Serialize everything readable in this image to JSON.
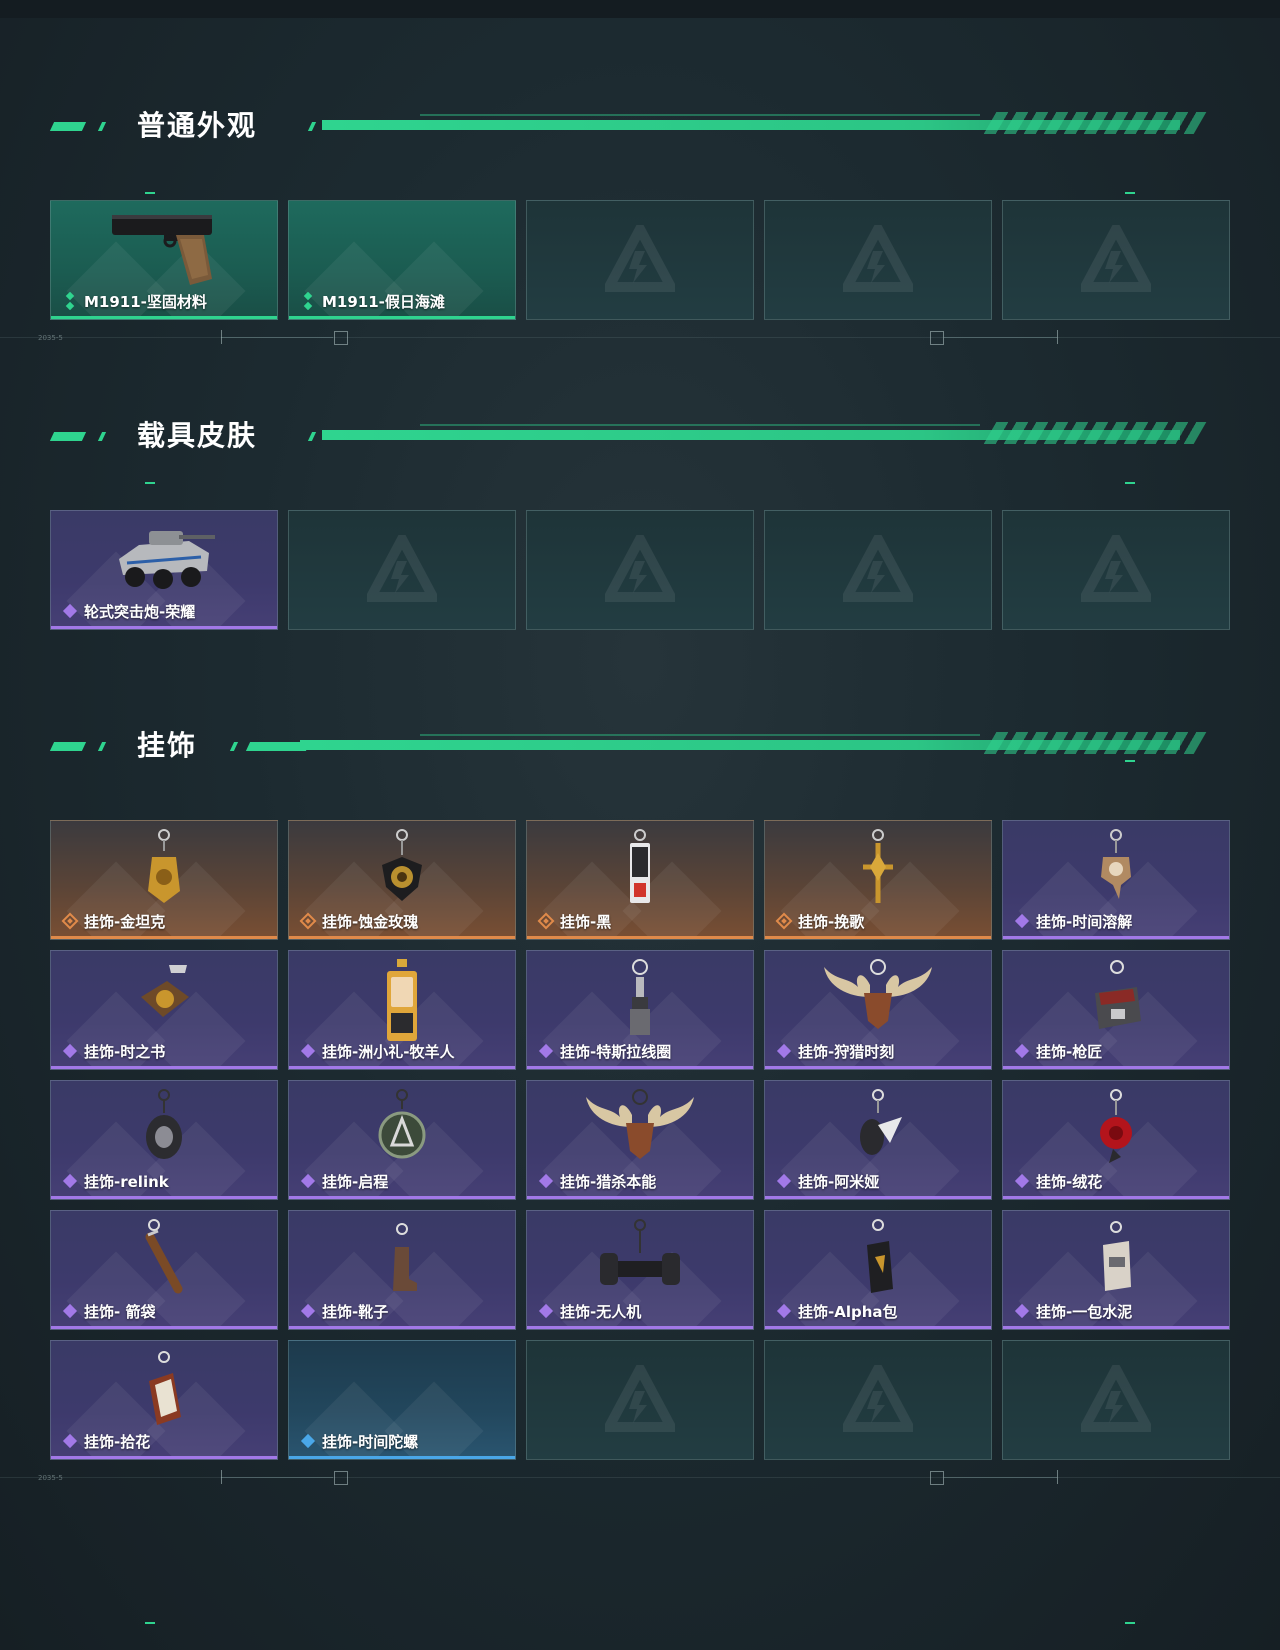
{
  "sections": {
    "normal": {
      "title": "普通外观",
      "items": [
        {
          "label": "M1911-坚固材料",
          "rarity": "green",
          "icon": "pistol-icon"
        },
        {
          "label": "M1911-假日海滩",
          "rarity": "green",
          "icon": ""
        }
      ]
    },
    "vehicle": {
      "title": "载具皮肤",
      "items": [
        {
          "label": "轮式突击炮-荣耀",
          "rarity": "purple",
          "icon": "armored-vehicle-icon"
        }
      ]
    },
    "charms": {
      "title": "挂饰",
      "items": [
        {
          "label": "挂饰-金坦克",
          "rarity": "orange",
          "icon": "gold-tank-charm-icon"
        },
        {
          "label": "挂饰-蚀金玫瑰",
          "rarity": "orange",
          "icon": "black-rose-charm-icon"
        },
        {
          "label": "挂饰-黑",
          "rarity": "orange",
          "icon": "card-charm-icon"
        },
        {
          "label": "挂饰-挽歌",
          "rarity": "orange",
          "icon": "golden-cross-charm-icon"
        },
        {
          "label": "挂饰-时间溶解",
          "rarity": "purple",
          "icon": "melting-clock-charm-icon"
        },
        {
          "label": "挂饰-时之书",
          "rarity": "purple",
          "icon": "book-charm-icon"
        },
        {
          "label": "挂饰-洲小礼-牧羊人",
          "rarity": "purple",
          "icon": "gift-box-charm-icon"
        },
        {
          "label": "挂饰-特斯拉线圈",
          "rarity": "purple",
          "icon": "tesla-coil-charm-icon"
        },
        {
          "label": "挂饰-狩猎时刻",
          "rarity": "purple",
          "icon": "antler-charm-icon"
        },
        {
          "label": "挂饰-枪匠",
          "rarity": "purple",
          "icon": "toolbox-charm-icon"
        },
        {
          "label": "挂饰-relink",
          "rarity": "purple",
          "icon": "turtle-charm-icon"
        },
        {
          "label": "挂饰-启程",
          "rarity": "purple",
          "icon": "compass-charm-icon"
        },
        {
          "label": "挂饰-猎杀本能",
          "rarity": "purple",
          "icon": "antler-charm-icon"
        },
        {
          "label": "挂饰-阿米娅",
          "rarity": "purple",
          "icon": "bunny-charm-icon"
        },
        {
          "label": "挂饰-绒花",
          "rarity": "purple",
          "icon": "red-rose-charm-icon"
        },
        {
          "label": "挂饰- 箭袋",
          "rarity": "purple",
          "icon": "quiver-charm-icon"
        },
        {
          "label": "挂饰-靴子",
          "rarity": "purple",
          "icon": "boot-charm-icon"
        },
        {
          "label": "挂饰-无人机",
          "rarity": "purple",
          "icon": "drone-charm-icon"
        },
        {
          "label": "挂饰-Alpha包",
          "rarity": "purple",
          "icon": "bag-charm-icon"
        },
        {
          "label": "挂饰-一包水泥",
          "rarity": "purple",
          "icon": "cement-bag-charm-icon"
        },
        {
          "label": "挂饰-拾花",
          "rarity": "purple",
          "icon": "frame-charm-icon"
        },
        {
          "label": "挂饰-时间陀螺",
          "rarity": "blue",
          "icon": ""
        }
      ]
    }
  },
  "hud": {
    "tiny_label": "2035-5"
  },
  "colors": {
    "accent": "#2fd48f",
    "green": "#2fd48f",
    "purple": "#a279e8",
    "orange": "#e08a4a",
    "blue": "#4aa7e8"
  }
}
